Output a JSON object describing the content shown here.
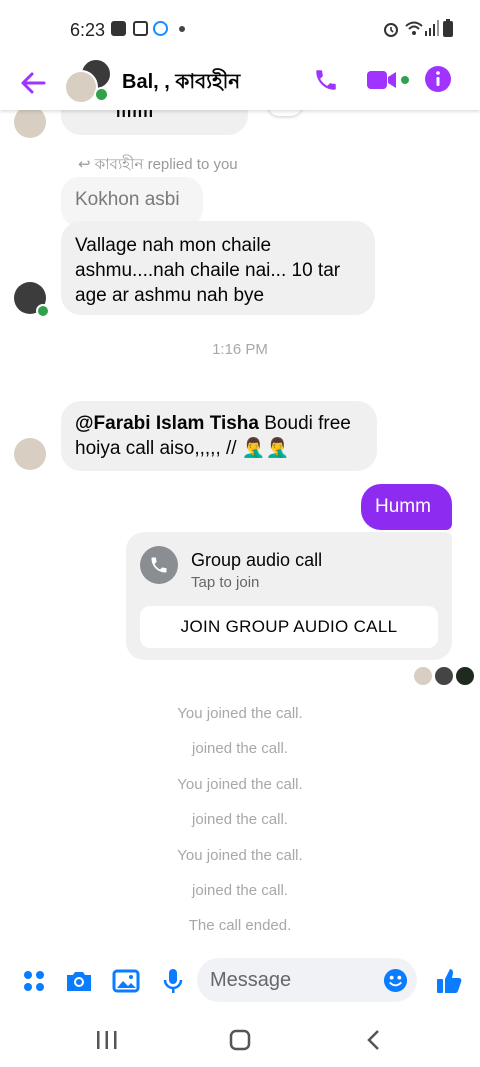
{
  "status": {
    "time": "6:23"
  },
  "header": {
    "title": "Bal, , কাব্যহীন"
  },
  "chat": {
    "partial_voice": "ıılılıı",
    "reply_note": "কাব্যহীন replied to you",
    "quoted_text": "Kokhon asbi",
    "reply_text_1": "Vallage nah mon chaile",
    "reply_text_2": "ashmu....nah chaile nai... 10 tar",
    "reply_text_3": "age ar ashmu nah bye",
    "timestamp": "1:16 PM",
    "mention": "@Farabi Islam Tisha",
    "mention_rest_1": " Boudi free",
    "mention_rest_2": "hoiya call aiso,,,,, // 🤦‍♂️🤦‍♂️",
    "my_message": "Humm",
    "call_card": {
      "title": "Group audio call",
      "subtitle": "Tap to join",
      "button": "JOIN GROUP AUDIO CALL"
    },
    "system_messages": [
      "You joined the call.",
      "joined the call.",
      "You joined the call.",
      "joined the call.",
      "You joined the call.",
      "joined the call.",
      "The call ended."
    ]
  },
  "composer": {
    "placeholder": "Message"
  },
  "colors": {
    "accent": "#a033ff",
    "bubble_out": "#8e2bf1",
    "messenger_blue": "#0a7cff",
    "online": "#31a24c"
  }
}
